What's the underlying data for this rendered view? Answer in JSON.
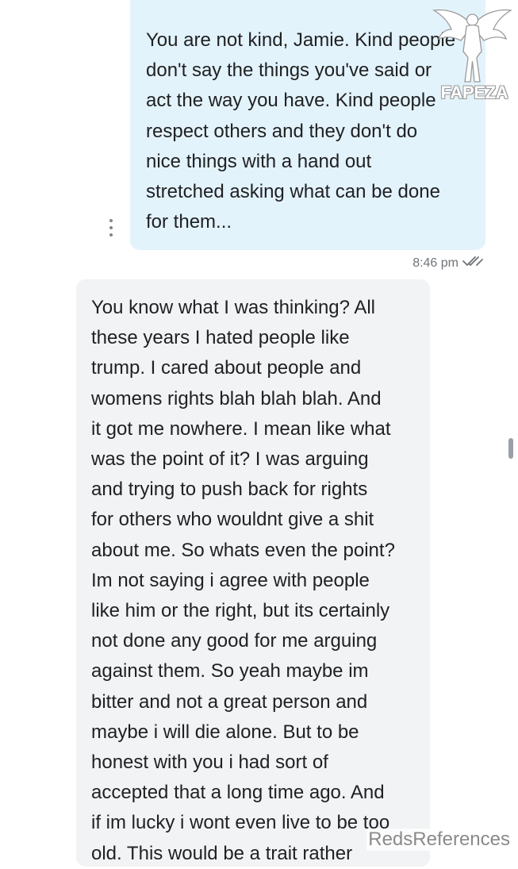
{
  "conversation": {
    "outgoing_message": {
      "text": "You are not kind, Jamie. Kind people\ndon't say the things you've said or\nact the way you have. Kind people\nrespect others and they don't do\nnice things with a hand out\nstretched asking what can be done\nfor them...",
      "timestamp": "8:46 pm",
      "status_icon": "double-check-icon"
    },
    "incoming_message": {
      "text": "You know what I was thinking? All\nthese years I hated people like\ntrump. I cared about people and\nwomens rights blah blah blah. And\nit got me nowhere. I mean like what\nwas the point of it? I was arguing\nand trying to push back for rights\nfor others who wouldnt give a shit\nabout me. So whats even the point?\nIm not saying i agree with people\nlike him or the right, but its certainly\nnot done any good for me arguing\nagainst them. So yeah maybe im\nbitter and not a great person and\nmaybe i will die alone. But to be\nhonest with you i had sort of\naccepted that a long time ago. And\nif im lucky i wont even live to be too\nold. This would be a trait rather"
    }
  },
  "watermarks": {
    "top_right": "FAPEZA",
    "bottom_right": "RedsReferences"
  },
  "colors": {
    "outgoing_bubble": "#e3f3fb",
    "incoming_bubble": "#f1f3f4",
    "text": "#202124",
    "meta_text": "#6f7378"
  }
}
